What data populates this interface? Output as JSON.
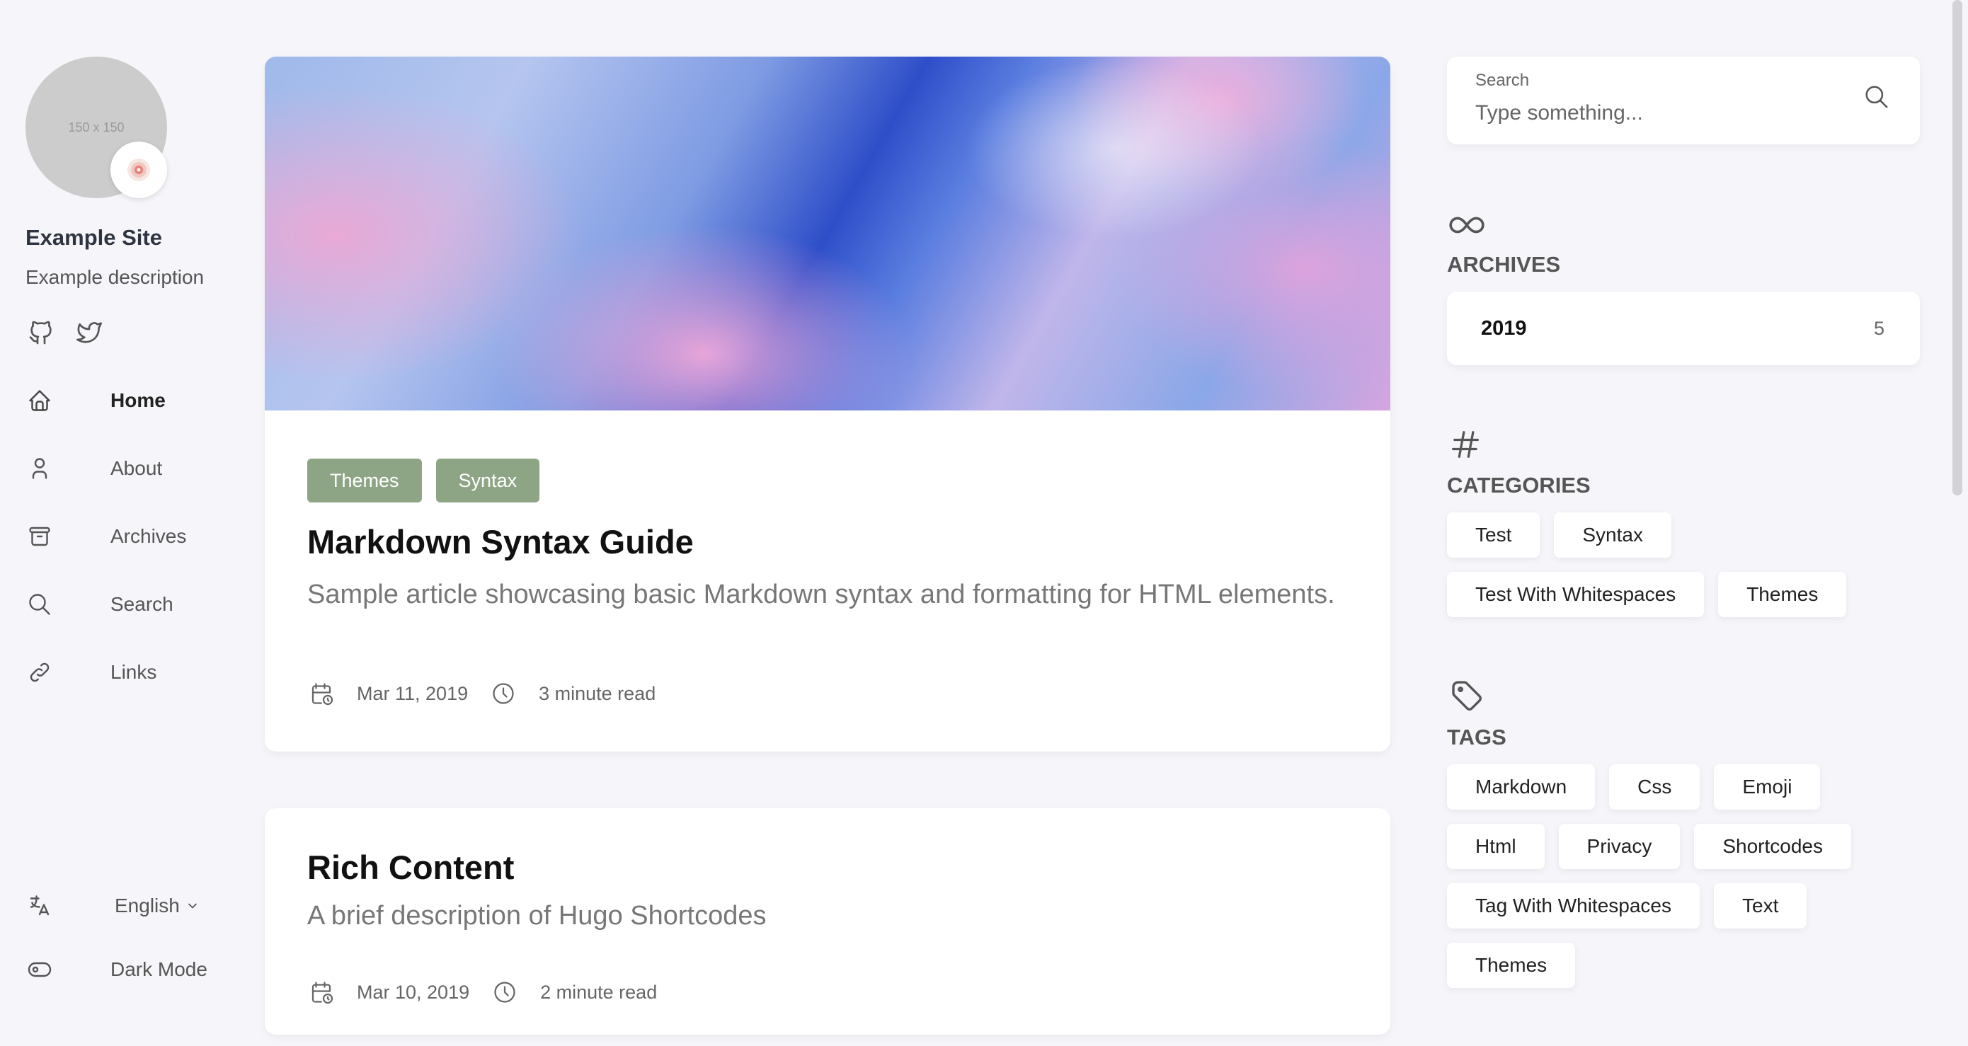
{
  "sidebar": {
    "avatar_placeholder": "150 x 150",
    "site_name": "Example Site",
    "site_description": "Example description",
    "social": [
      {
        "icon": "github-icon"
      },
      {
        "icon": "twitter-icon"
      }
    ],
    "nav": [
      {
        "label": "Home",
        "icon": "home-icon",
        "active": true
      },
      {
        "label": "About",
        "icon": "user-icon"
      },
      {
        "label": "Archives",
        "icon": "archive-box-icon"
      },
      {
        "label": "Search",
        "icon": "search-icon"
      },
      {
        "label": "Links",
        "icon": "link-icon"
      }
    ],
    "language": {
      "label": "English",
      "icon": "language-icon"
    },
    "dark_mode": {
      "label": "Dark Mode",
      "icon": "toggle-icon"
    }
  },
  "articles": [
    {
      "categories": [
        "Themes",
        "Syntax"
      ],
      "title": "Markdown Syntax Guide",
      "description": "Sample article showcasing basic Markdown syntax and formatting for HTML elements.",
      "date": "Mar 11, 2019",
      "read_time": "3 minute read"
    },
    {
      "categories": [],
      "title": "Rich Content",
      "description": "A brief description of Hugo Shortcodes",
      "date": "Mar 10, 2019",
      "read_time": "2 minute read"
    }
  ],
  "right": {
    "search": {
      "label": "Search",
      "placeholder": "Type something..."
    },
    "archives": {
      "title": "ARCHIVES",
      "items": [
        {
          "year": "2019",
          "count": "5"
        }
      ]
    },
    "categories": {
      "title": "CATEGORIES",
      "rows": [
        [
          "Test",
          "Syntax"
        ],
        [
          "Test With Whitespaces",
          "Themes"
        ]
      ]
    },
    "tags": {
      "title": "TAGS",
      "rows": [
        [
          "Markdown",
          "Css",
          "Emoji"
        ],
        [
          "Html",
          "Privacy",
          "Shortcodes"
        ],
        [
          "Tag With Whitespaces",
          "Text"
        ],
        [
          "Themes"
        ]
      ]
    }
  },
  "colors": {
    "category_tag": "#8ea585",
    "background": "#f5f5fa",
    "card": "#ffffff"
  }
}
